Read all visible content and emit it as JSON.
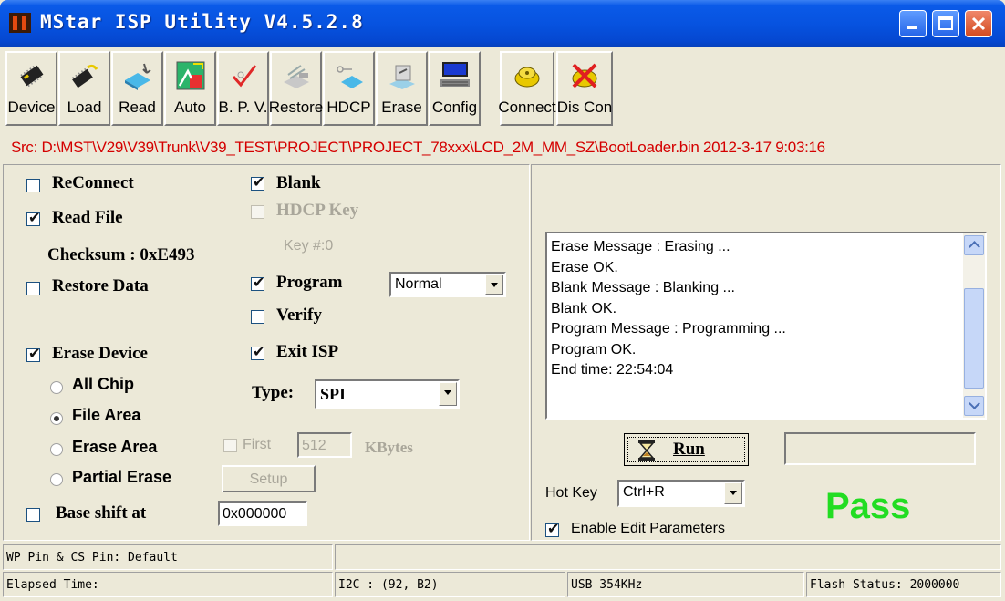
{
  "window": {
    "title": "MStar ISP Utility V4.5.2.8",
    "accent_color": "#0a5ae8",
    "controls": [
      "minimize-icon",
      "maximize-icon",
      "close-icon"
    ]
  },
  "toolbar": [
    {
      "label": "Device",
      "icon": "chip-icon",
      "enabled": true
    },
    {
      "label": "Load",
      "icon": "chip-load-icon",
      "enabled": true
    },
    {
      "label": "Read",
      "icon": "read-icon",
      "enabled": true
    },
    {
      "label": "Auto",
      "icon": "auto-icon",
      "enabled": true
    },
    {
      "label": "B. P. V.",
      "icon": "check-icon",
      "enabled": true
    },
    {
      "label": "Restore",
      "icon": "restore-icon",
      "enabled": true
    },
    {
      "label": "HDCP",
      "icon": "hdcp-icon",
      "enabled": true
    },
    {
      "label": "Erase",
      "icon": "erase-icon",
      "enabled": true
    },
    {
      "label": "Config",
      "icon": "computer-icon",
      "enabled": true
    },
    {
      "label": "Connect",
      "icon": "connect-icon",
      "enabled": true
    },
    {
      "label": "Dis Con",
      "icon": "disconnect-icon",
      "enabled": true
    }
  ],
  "source_line": "Src: D:\\MST\\V29\\V39\\Trunk\\V39_TEST\\PROJECT\\PROJECT_78xxx\\LCD_2M_MM_SZ\\BootLoader.bin 2012-3-17 9:03:16",
  "options": {
    "reconnect": {
      "label": "ReConnect",
      "checked": false
    },
    "read_file": {
      "label": "Read File",
      "checked": true
    },
    "checksum": "Checksum : 0xE493",
    "restore_data": {
      "label": "Restore Data",
      "checked": false
    },
    "erase_device": {
      "label": "Erase Device",
      "checked": true
    },
    "erase_modes": [
      {
        "label": "All Chip",
        "selected": false
      },
      {
        "label": "File Area",
        "selected": true
      },
      {
        "label": "Erase Area",
        "selected": false
      },
      {
        "label": "Partial Erase",
        "selected": false
      }
    ],
    "base_shift": {
      "label": "Base shift at",
      "checked": false,
      "value": "0x000000"
    },
    "blank": {
      "label": "Blank",
      "checked": true
    },
    "hdcp_key": {
      "label": "HDCP Key",
      "checked": false,
      "disabled": true
    },
    "key_no": "Key #:0",
    "program": {
      "label": "Program",
      "checked": true,
      "mode": "Normal"
    },
    "verify": {
      "label": "Verify",
      "checked": false
    },
    "exit_isp": {
      "label": "Exit ISP",
      "checked": true
    },
    "type": {
      "label": "Type:",
      "value": "SPI"
    },
    "first": {
      "label": "First",
      "checked": false,
      "value": "512",
      "unit": "KBytes"
    },
    "setup_label": "Setup"
  },
  "log": [
    "Erase Message : Erasing ...",
    "Erase OK.",
    "Blank Message : Blanking ...",
    "Blank OK.",
    "Program Message : Programming ...",
    "Program OK.",
    "End time: 22:54:04"
  ],
  "run": {
    "label": "Run",
    "icon": "hourglass-icon"
  },
  "hot_key": {
    "label": "Hot Key",
    "value": "Ctrl+R"
  },
  "enable_edit": {
    "label": "Enable Edit Parameters",
    "checked": true
  },
  "result": {
    "text": "Pass",
    "color": "#22dd22"
  },
  "status": {
    "pins": "WP Pin & CS Pin: Default",
    "elapsed": "Elapsed Time:",
    "i2c": "I2C :  (92,  B2)",
    "usb": "USB  354KHz",
    "flash": "Flash Status: 2000000"
  }
}
